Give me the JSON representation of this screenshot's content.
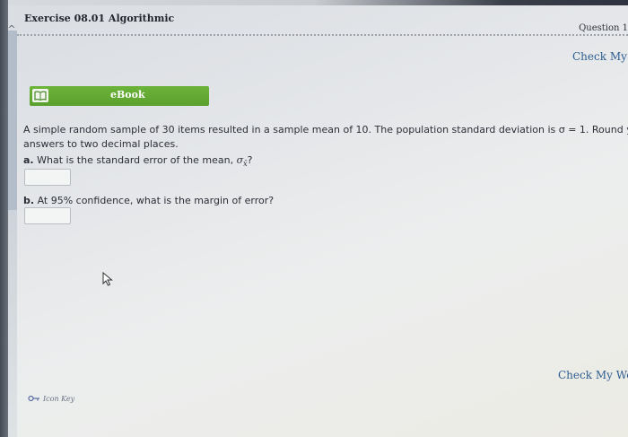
{
  "header": {
    "exercise_title": "Exercise 08.01 Algorithmic",
    "question_label": "Question 1",
    "collapse_glyph": "^"
  },
  "check_my_work": {
    "top_label": "Check My W",
    "bottom_label": "Check My Wor"
  },
  "ebook": {
    "label": "eBook",
    "icon": "book-icon",
    "color": "#5aa02c"
  },
  "problem": {
    "line1": "A simple random sample of 30 items resulted in a sample mean of 10. The population standard deviation is σ = 1. Round your",
    "line2": "answers to two decimal places."
  },
  "questions": [
    {
      "letter": "a.",
      "text": "What is the standard error of the mean, ",
      "symbol": "σ",
      "subscript": "x̄",
      "suffix": "?",
      "answer": ""
    },
    {
      "letter": "b.",
      "text": "At 95% confidence, what is the margin of error?",
      "answer": ""
    }
  ],
  "footer": {
    "icon_key_label": "Icon Key",
    "icon": "key-icon"
  },
  "colors": {
    "link": "#2f5d8f",
    "ebook_green": "#5aa02c",
    "side_rail": "#b3bdc9"
  }
}
